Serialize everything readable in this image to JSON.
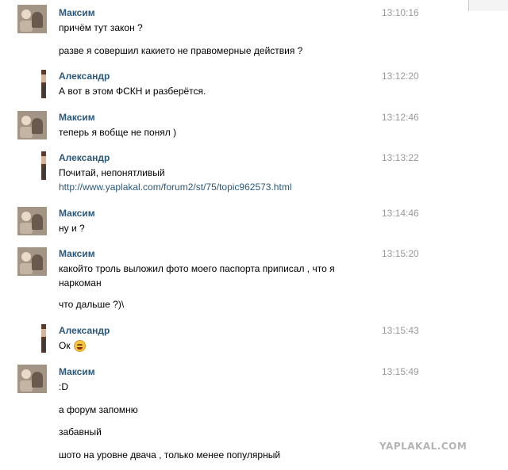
{
  "messages": [
    {
      "sender": "Максим",
      "time": "13:10:16",
      "lines": [
        "причём тут закон ?",
        "разве я совершил какието не правомерные действия ?"
      ]
    },
    {
      "sender": "Александр",
      "time": "13:12:20",
      "lines": [
        "А вот в этом ФСКН и разберётся."
      ]
    },
    {
      "sender": "Максим",
      "time": "13:12:46",
      "lines": [
        "теперь я вобще не понял )"
      ]
    },
    {
      "sender": "Александр",
      "time": "13:13:22",
      "lines": [
        "Почитай, непонятливый"
      ],
      "link": "http://www.yaplakal.com/forum2/st/75/topic962573.html"
    },
    {
      "sender": "Максим",
      "time": "13:14:46",
      "lines": [
        "ну и ?"
      ]
    },
    {
      "sender": "Максим",
      "time": "13:15:20",
      "lines": [
        "какойто троль выложил фото моего паспорта приписал , что я",
        "наркоман",
        "что дальше ?)\\"
      ]
    },
    {
      "sender": "Александр",
      "time": "13:15:43",
      "lines": [
        "Ок"
      ],
      "emoji": "laughing-emoji"
    },
    {
      "sender": "Максим",
      "time": "13:15:49",
      "lines": [
        ":D",
        "а форум запомню",
        "забавный",
        "шото на уровне двача , только менее популярный"
      ]
    }
  ],
  "watermark": "YAPLAKAL.COM"
}
